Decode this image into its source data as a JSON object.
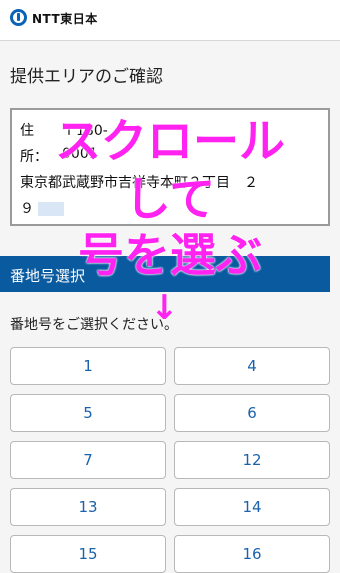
{
  "header": {
    "logo_text": "NTT東日本"
  },
  "page": {
    "title": "提供エリアのご確認"
  },
  "address": {
    "key1": "住",
    "val1": "〒180-",
    "key2": "所：",
    "val2": "0001",
    "line1": "東京都武蔵野市吉祥寺本町２丁目　２",
    "line2": "９"
  },
  "section": {
    "label": "番地号選択",
    "instruction": "番地号をご選択ください。"
  },
  "options": [
    "1",
    "4",
    "5",
    "6",
    "7",
    "12",
    "13",
    "14",
    "15",
    "16"
  ],
  "overlay": {
    "line1": "スクロール",
    "line2": "して",
    "line3": "号を選ぶ",
    "arrow": "↓"
  },
  "colors": {
    "brand_blue": "#0a5aa0",
    "link_blue": "#1a62ad",
    "overlay_magenta": "#ff22f0"
  }
}
